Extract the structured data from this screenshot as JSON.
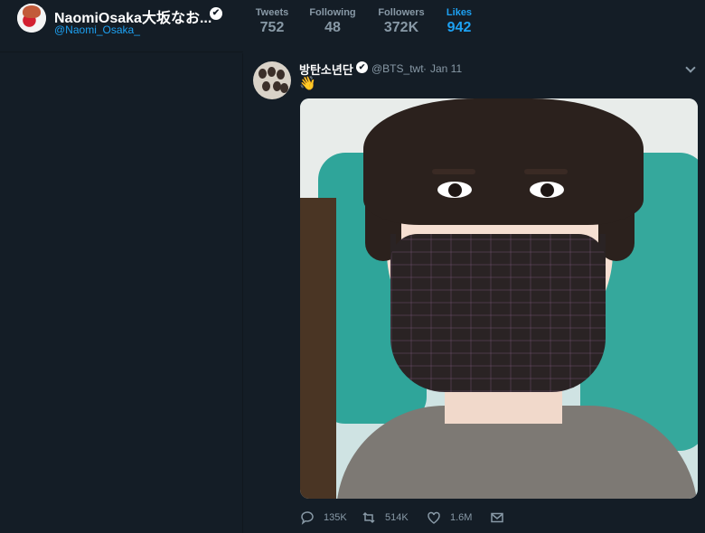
{
  "profile": {
    "display_name": "NaomiOsaka大坂なお...",
    "handle": "@Naomi_Osaka_",
    "verified_mark": "✔"
  },
  "stats": [
    {
      "label": "Tweets",
      "value": "752"
    },
    {
      "label": "Following",
      "value": "48"
    },
    {
      "label": "Followers",
      "value": "372K"
    },
    {
      "label": "Likes",
      "value": "942"
    }
  ],
  "active_stat": "Likes",
  "tweet": {
    "author_name": "방탄소년단",
    "author_handle": "@BTS_twt",
    "separator": "·",
    "date": "Jan 11",
    "text": "👋",
    "verified_mark": "✔",
    "actions": {
      "reply_count": "135K",
      "retweet_count": "514K",
      "like_count": "1.6M"
    }
  },
  "icons": {
    "reply": "speech-bubble-icon",
    "retweet": "retweet-icon",
    "like": "heart-icon",
    "message": "envelope-icon",
    "menu": "chevron-down-icon"
  },
  "colors": {
    "background": "#141d26",
    "accent": "#1da1f2",
    "muted": "#8899a6"
  }
}
